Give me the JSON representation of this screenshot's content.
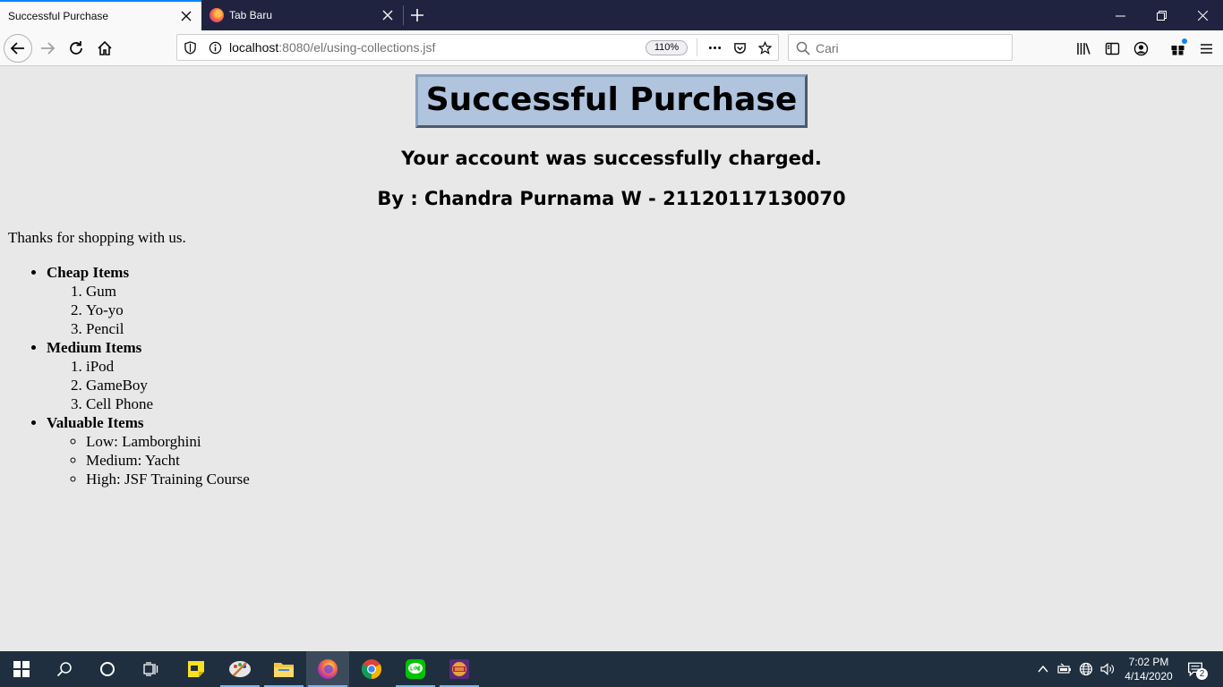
{
  "browser": {
    "tabs": [
      {
        "title": "Successful Purchase",
        "active": true
      },
      {
        "title": "Tab Baru",
        "active": false
      }
    ],
    "url_host": "localhost",
    "url_path": ":8080/el/using-collections.jsf",
    "zoom": "110%",
    "search_placeholder": "Cari",
    "accent_color": "#0a84ff"
  },
  "page": {
    "title": "Successful Purchase",
    "subtitle": "Your account was successfully charged.",
    "byline": "By : Chandra Purnama W - 21120117130070",
    "thanks": "Thanks for shopping with us.",
    "categories": [
      {
        "label": "Cheap Items",
        "list_style": "ordered",
        "items": [
          "Gum",
          "Yo-yo",
          "Pencil"
        ]
      },
      {
        "label": "Medium Items",
        "list_style": "ordered",
        "items": [
          "iPod",
          "GameBoy",
          "Cell Phone"
        ]
      },
      {
        "label": "Valuable Items",
        "list_style": "circle",
        "items": [
          "Low: Lamborghini",
          "Medium: Yacht",
          "High: JSF Training Course"
        ]
      }
    ],
    "title_background": "#b0c4de",
    "page_background": "#e8e8e8"
  },
  "taskbar": {
    "apps": [
      "windows-start",
      "search",
      "cortana",
      "task-view",
      "sticky-notes",
      "paint",
      "file-explorer",
      "firefox",
      "chrome",
      "line",
      "game"
    ],
    "time": "7:02 PM",
    "date": "4/14/2020",
    "notification_count": "2"
  }
}
